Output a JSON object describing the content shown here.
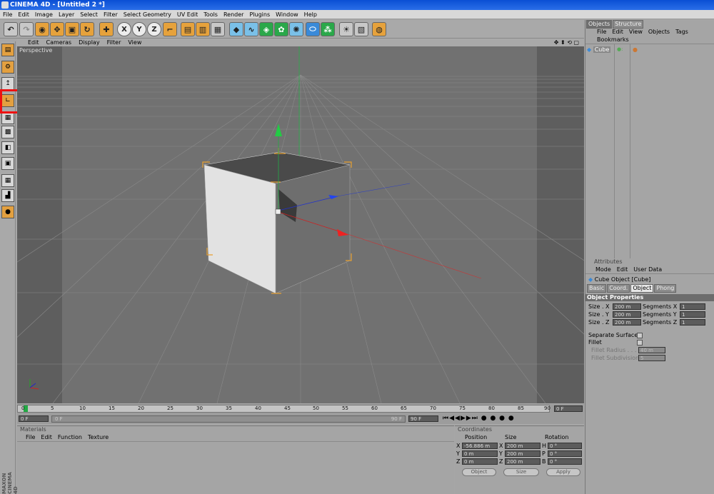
{
  "window": {
    "title": "CINEMA 4D - [Untitled 2 *]"
  },
  "menu": [
    "File",
    "Edit",
    "Image",
    "Layer",
    "Select",
    "Filter",
    "Select Geometry",
    "UV Edit",
    "Tools",
    "Render",
    "Plugins",
    "Window",
    "Help"
  ],
  "toolbar": {
    "x": "X",
    "y": "Y",
    "z": "Z",
    "icons": [
      "undo-icon",
      "redo-icon",
      "live-select-icon",
      "move-icon",
      "scale-icon",
      "rotate-icon",
      "add-icon",
      "x-axis-icon",
      "y-axis-icon",
      "z-axis-icon",
      "world-coords-icon",
      "render-view-icon",
      "render-picture-viewer-icon",
      "render-settings-icon",
      "cube-primitive-icon",
      "spline-icon",
      "nurbs-icon",
      "array-icon",
      "scene-icon",
      "deformer-icon",
      "particle-icon",
      "light-icon",
      "camera-icon",
      "floor-icon"
    ]
  },
  "viewport": {
    "menu": [
      "Edit",
      "Cameras",
      "Display",
      "Filter",
      "View"
    ],
    "label": "Perspective"
  },
  "timeline": {
    "ticks": [
      "0",
      "5",
      "10",
      "15",
      "20",
      "25",
      "30",
      "35",
      "40",
      "45",
      "50",
      "55",
      "60",
      "65",
      "70",
      "75",
      "80",
      "85",
      "90"
    ],
    "current": "0 F",
    "start": "0 F",
    "end": "90 F",
    "field_left": "0 F",
    "field_right": "0 F",
    "field_mid": "90 F"
  },
  "materials": {
    "title": "Materials",
    "menu": [
      "File",
      "Edit",
      "Function",
      "Texture"
    ]
  },
  "coords": {
    "title": "Coordinates",
    "headers": [
      "Position",
      "Size",
      "Rotation"
    ],
    "rows": [
      {
        "a": "X",
        "pos": "-56.886 m",
        "b": "X",
        "size": "200 m",
        "c": "H",
        "rot": "0 °"
      },
      {
        "a": "Y",
        "pos": "0 m",
        "b": "Y",
        "size": "200 m",
        "c": "P",
        "rot": "0 °"
      },
      {
        "a": "Z",
        "pos": "0 m",
        "b": "Z",
        "size": "200 m",
        "c": "B",
        "rot": "0 °"
      }
    ],
    "mode1": "Object",
    "mode2": "Size",
    "apply": "Apply"
  },
  "objects": {
    "tabs": [
      "Objects",
      "Structure"
    ],
    "menu": [
      "File",
      "Edit",
      "View",
      "Objects",
      "Tags",
      "Bookmarks"
    ],
    "item": "Cube"
  },
  "attributes": {
    "title": "Attributes",
    "menu": [
      "Mode",
      "Edit",
      "User Data"
    ],
    "object": "Cube Object [Cube]",
    "tabs": [
      "Basic",
      "Coord.",
      "Object",
      "Phong"
    ],
    "section": "Object Properties",
    "size_x_label": "Size . X",
    "size_x": "200 m",
    "size_y_label": "Size . Y",
    "size_y": "200 m",
    "size_z_label": "Size . Z",
    "size_z": "200 m",
    "seg_x_label": "Segments X",
    "seg_x": "1",
    "seg_y_label": "Segments Y",
    "seg_y": "1",
    "seg_z_label": "Segments Z",
    "seg_z": "1",
    "separate": "Separate Surfaces",
    "fillet": "Fillet",
    "fillet_radius": "Fillet Radius . . . . . . .",
    "fillet_radius_val": "40 m",
    "fillet_sub": "Fillet Subdivision",
    "fillet_sub_val": "5"
  },
  "logo": "MAXON CINEMA 4D"
}
